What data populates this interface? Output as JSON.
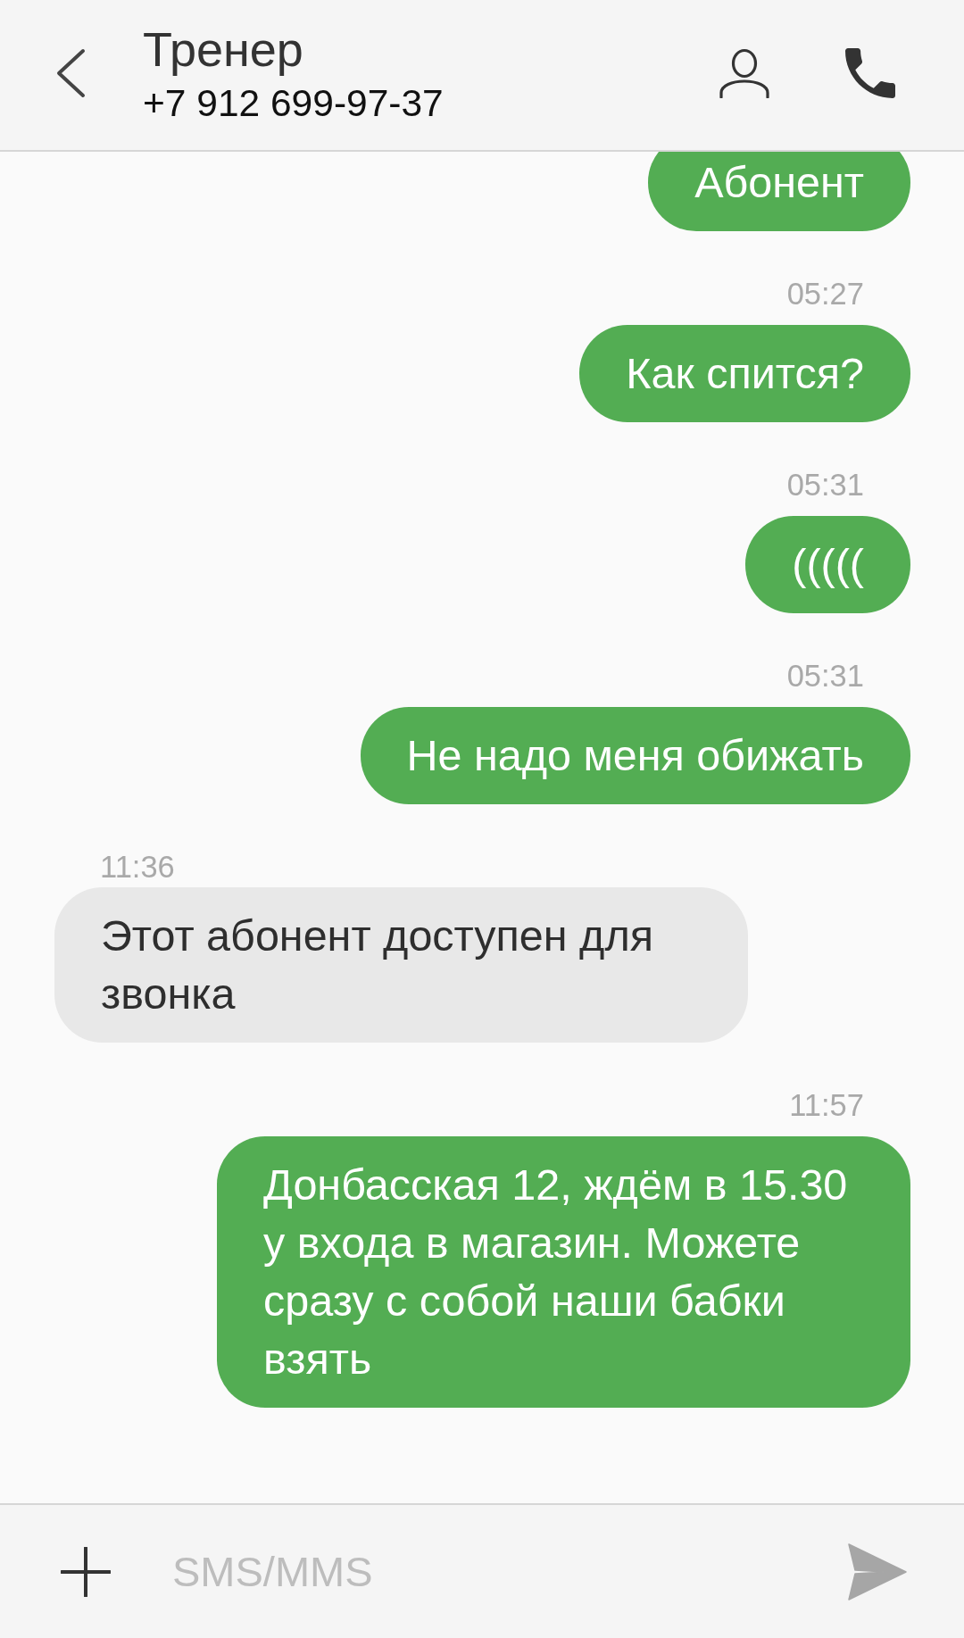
{
  "header": {
    "title": "Тренер",
    "phone": "+7 912 699-97-37"
  },
  "messages": [
    {
      "kind": "outgoing",
      "text": "Абонент"
    },
    {
      "kind": "outgoing",
      "time": "05:27",
      "text": "Как спится?"
    },
    {
      "kind": "outgoing",
      "time": "05:31",
      "text": "((((("
    },
    {
      "kind": "outgoing",
      "time": "05:31",
      "text": "Не надо меня обижать"
    },
    {
      "kind": "incoming",
      "time": "11:36",
      "text": "Этот абонент доступен для звонка"
    },
    {
      "kind": "outgoing",
      "time": "11:57",
      "text": "Донбасская 12, ждём в 15.30 у входа в магазин. Можете сразу с собой наши бабки взять"
    }
  ],
  "composer": {
    "placeholder": "SMS/MMS"
  }
}
